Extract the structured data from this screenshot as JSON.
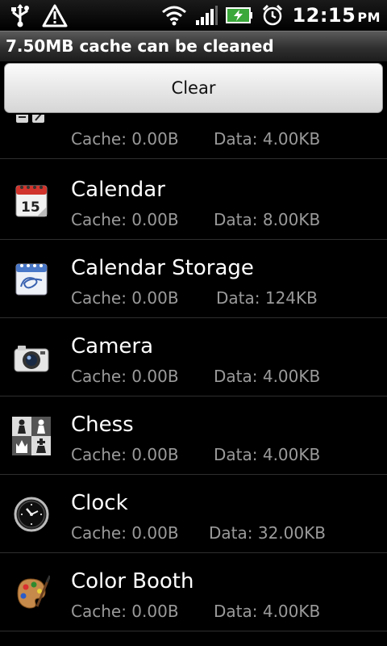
{
  "status_bar": {
    "time": "12:15",
    "ampm": "PM",
    "icons": [
      "usb-icon",
      "warning-icon",
      "wifi-icon",
      "signal-icon",
      "battery-charging-icon",
      "alarm-icon"
    ]
  },
  "header": {
    "text": "7.50MB cache can be cleaned"
  },
  "clear_button": {
    "label": "Clear"
  },
  "apps": [
    {
      "name": "",
      "cache": "Cache: 0.00B",
      "data": "Data: 4.00KB",
      "icon": "app-icon"
    },
    {
      "name": "Calendar",
      "cache": "Cache: 0.00B",
      "data": "Data: 8.00KB",
      "icon": "calendar-icon"
    },
    {
      "name": "Calendar Storage",
      "cache": "Cache: 0.00B",
      "data": "Data: 124KB",
      "icon": "calendar-storage-icon"
    },
    {
      "name": "Camera",
      "cache": "Cache: 0.00B",
      "data": "Data: 4.00KB",
      "icon": "camera-icon"
    },
    {
      "name": "Chess",
      "cache": "Cache: 0.00B",
      "data": "Data: 4.00KB",
      "icon": "chess-icon"
    },
    {
      "name": "Clock",
      "cache": "Cache: 0.00B",
      "data": "Data: 32.00KB",
      "icon": "clock-icon"
    },
    {
      "name": "Color Booth",
      "cache": "Cache: 0.00B",
      "data": "Data: 4.00KB",
      "icon": "color-booth-icon"
    }
  ]
}
